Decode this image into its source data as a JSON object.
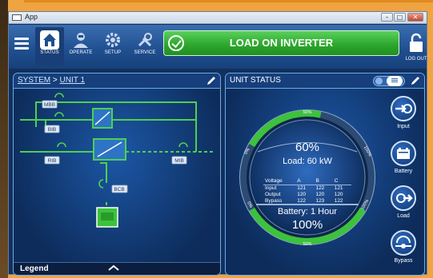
{
  "window": {
    "title": "App",
    "minimize": "–",
    "maximize": "□",
    "close": "✕"
  },
  "toolbar": {
    "tabs": [
      {
        "label": "STATUS"
      },
      {
        "label": "OPERATE"
      },
      {
        "label": "SETUP"
      },
      {
        "label": "SERVICE"
      }
    ],
    "banner": "LOAD ON INVERTER",
    "logout": "LOG OUT"
  },
  "left_panel": {
    "breadcrumb_root": "SYSTEM",
    "breadcrumb_sep": " > ",
    "breadcrumb_leaf": "UNIT 1",
    "breakers": {
      "mbb": "MBB",
      "bib": "BIB",
      "rib": "RIB",
      "mib": "MIB",
      "bcb": "BCB"
    },
    "legend": "Legend"
  },
  "right_panel": {
    "title": "UNIT STATUS",
    "gauge": {
      "top_tick": "50%",
      "left_tick": "0%",
      "right_tick": "100%",
      "load_pct": "60%",
      "load_kw": "Load: 60 kW",
      "battery_time": "Battery: 1 Hour",
      "battery_pct": "100%",
      "bottom_left_tick": "0%",
      "bottom_tick": "50%",
      "bottom_right_tick": "100%",
      "load_level": 0.6,
      "battery_level": 1.0
    },
    "voltage_table": {
      "headers": [
        "Voltage",
        "A",
        "B",
        "C"
      ],
      "rows": [
        [
          "Input",
          "121",
          "122",
          "121"
        ],
        [
          "Output",
          "120",
          "120",
          "120"
        ],
        [
          "Bypass",
          "122",
          "123",
          "122"
        ]
      ]
    },
    "buttons": [
      {
        "label": "Input"
      },
      {
        "label": "Battery"
      },
      {
        "label": "Load"
      },
      {
        "label": "Bypass"
      }
    ]
  },
  "colors": {
    "accent_green": "#3cc23c",
    "panel_blue": "#12305e",
    "highlight": "#efa341"
  }
}
